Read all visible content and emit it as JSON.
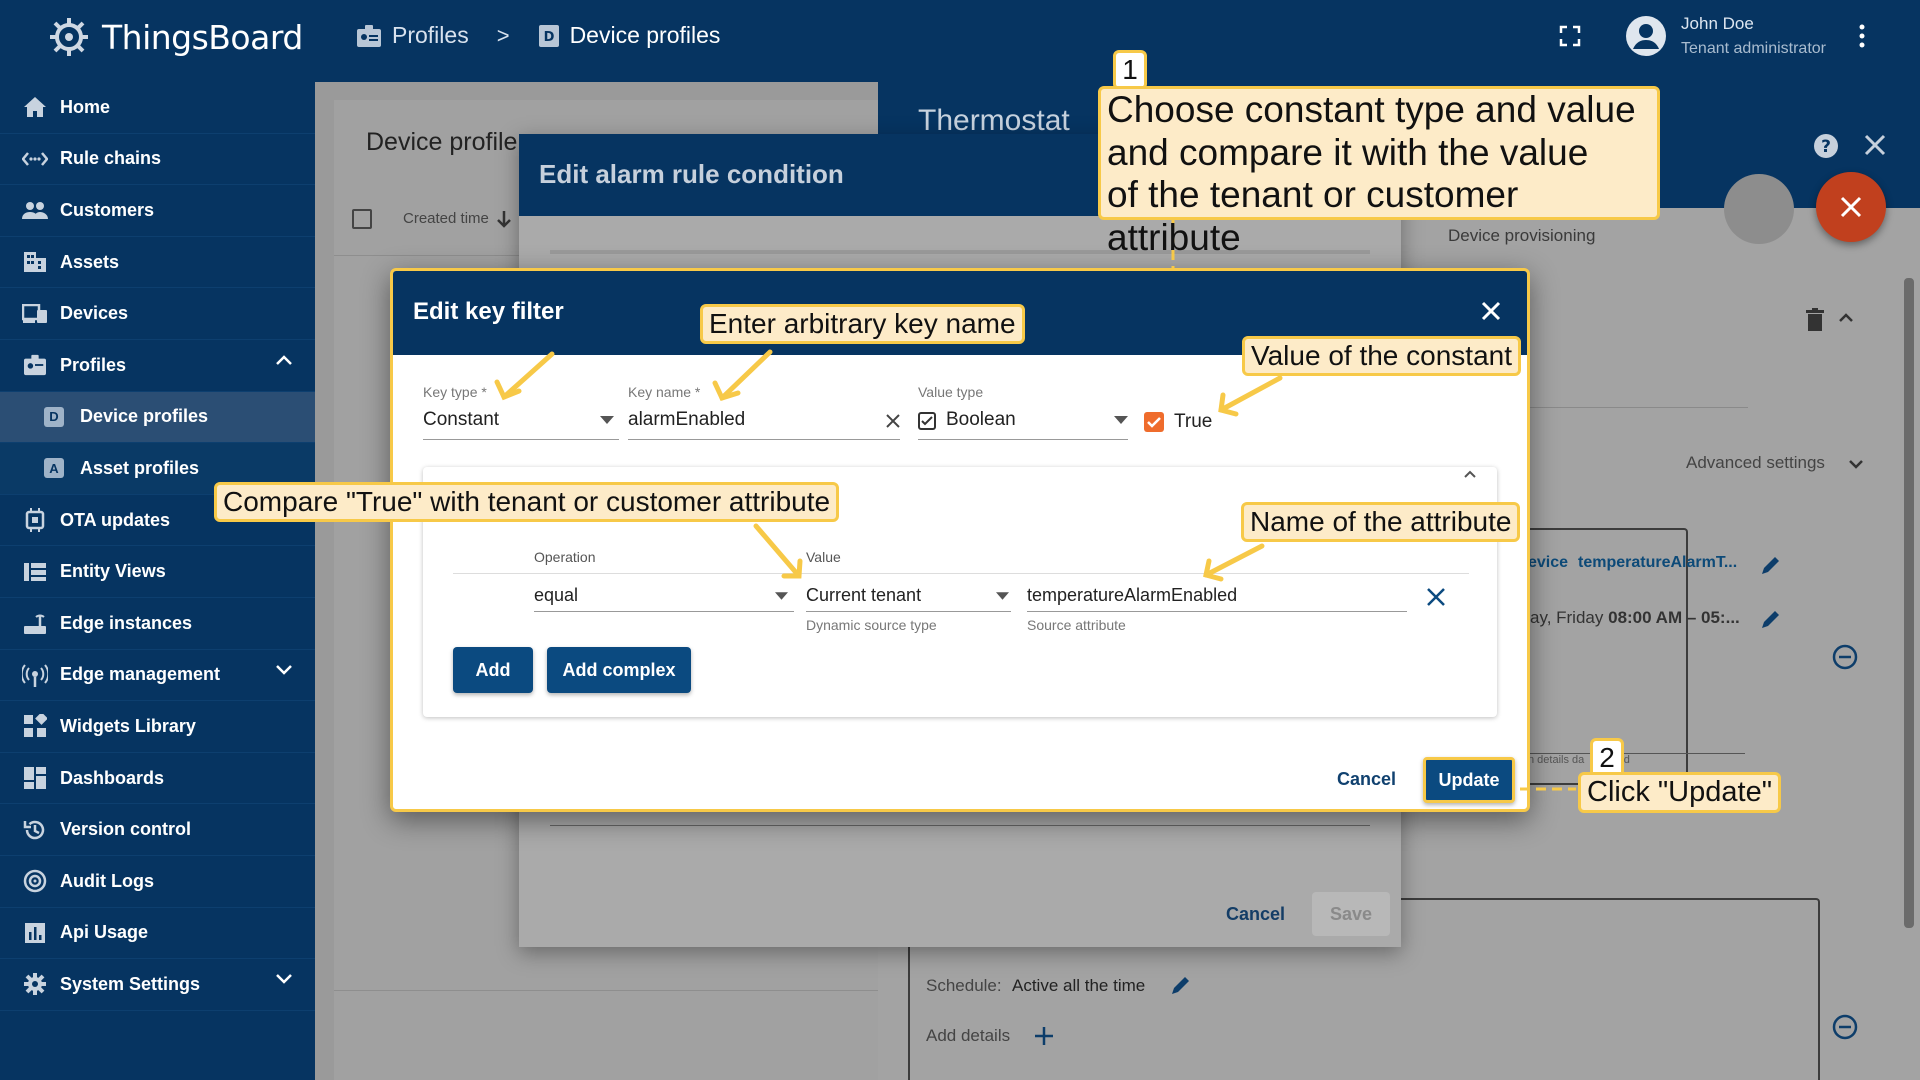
{
  "app": {
    "name": "ThingsBoard"
  },
  "breadcrumb": {
    "profiles": "Profiles",
    "separator": ">",
    "device_profiles": "Device profiles"
  },
  "user": {
    "name": "John Doe",
    "role": "Tenant administrator"
  },
  "sidebar": {
    "items": [
      {
        "label": "Home",
        "icon": "home-icon"
      },
      {
        "label": "Rule chains",
        "icon": "rule-chain-icon"
      },
      {
        "label": "Customers",
        "icon": "customers-icon"
      },
      {
        "label": "Assets",
        "icon": "assets-icon"
      },
      {
        "label": "Devices",
        "icon": "devices-icon"
      },
      {
        "label": "Profiles",
        "icon": "profiles-icon"
      },
      {
        "label": "Device profiles",
        "icon": "device-profile-icon"
      },
      {
        "label": "Asset profiles",
        "icon": "asset-profile-icon"
      },
      {
        "label": "OTA updates",
        "icon": "ota-icon"
      },
      {
        "label": "Entity Views",
        "icon": "entity-views-icon"
      },
      {
        "label": "Edge instances",
        "icon": "edge-icon"
      },
      {
        "label": "Edge management",
        "icon": "edge-management-icon"
      },
      {
        "label": "Widgets Library",
        "icon": "widgets-icon"
      },
      {
        "label": "Dashboards",
        "icon": "dashboards-icon"
      },
      {
        "label": "Version control",
        "icon": "version-control-icon"
      },
      {
        "label": "Audit Logs",
        "icon": "audit-logs-icon"
      },
      {
        "label": "Api Usage",
        "icon": "api-usage-icon"
      },
      {
        "label": "System Settings",
        "icon": "settings-icon"
      }
    ]
  },
  "background": {
    "left_panel_title": "Device profile",
    "created_time": "Created time",
    "right_panel_title": "Thermostat",
    "device_provisioning": "Device provisioning",
    "advanced_settings": "Advanced settings",
    "key_chip_1": "evice",
    "key_chip_2": "temperatureAlarmT...",
    "schedule_text_1": "ay, Friday",
    "schedule_text_2": "08:00 AM – 05:...",
    "details_hint": "n details da",
    "details_hint_2": "ard",
    "schedule_label": "Schedule:",
    "schedule_value": "Active all the time",
    "add_details": "Add details"
  },
  "alarm_dialog": {
    "title": "Edit alarm rule condition",
    "cancel": "Cancel",
    "save": "Save"
  },
  "key_filter_dialog": {
    "title": "Edit key filter",
    "key_type_label": "Key type *",
    "key_type_value": "Constant",
    "key_name_label": "Key name *",
    "key_name_value": "alarmEnabled",
    "value_type_label": "Value type",
    "value_type_value": "Boolean",
    "checkbox_label": "True",
    "operation_label": "Operation",
    "operation_value": "equal",
    "value_label": "Value",
    "value_value": "Current tenant",
    "value_hint": "Dynamic source type",
    "attribute_value": "temperatureAlarmEnabled",
    "attribute_hint": "Source attribute",
    "add_button": "Add",
    "add_complex_button": "Add complex",
    "cancel_button": "Cancel",
    "update_button": "Update"
  },
  "annotations": {
    "step1_number": "1",
    "step1_line1": "Choose constant type and value",
    "step1_line2": "and compare it with the value",
    "step1_line3": "of the tenant or customer attribute",
    "key_name_hint": "Enter arbitrary key name",
    "constant_value_hint": "Value of the constant",
    "compare_hint": "Compare \"True\" with tenant or customer attribute",
    "attribute_name_hint": "Name of the attribute",
    "step2_number": "2",
    "step2_text": "Click \"Update\""
  },
  "colors": {
    "navy": "#063461",
    "accent_orange": "#c1401e",
    "callout_border": "#f7c948",
    "callout_fill": "#fdebc8",
    "checkbox": "#ef6c2c",
    "button_blue": "#0b4a80"
  }
}
